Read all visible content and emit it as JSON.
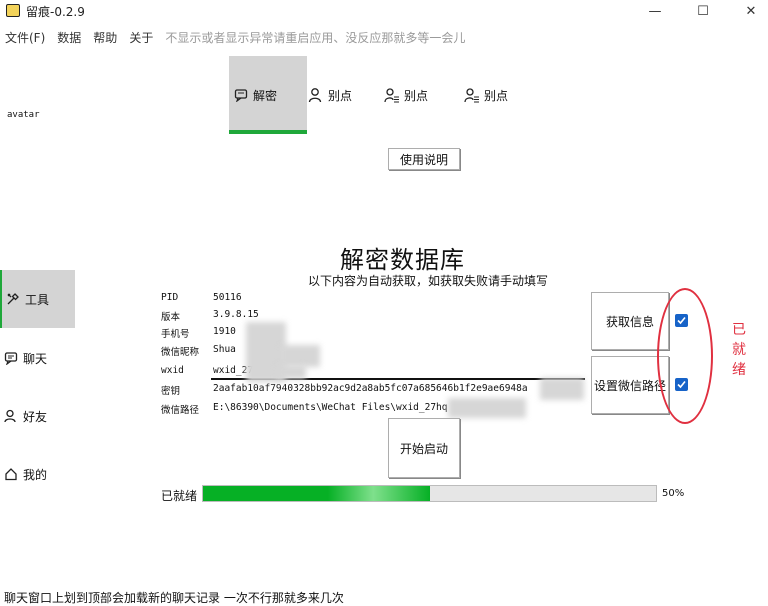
{
  "window": {
    "title": "留痕-0.2.9",
    "controls": {
      "minimize": "—",
      "maximize": "☐",
      "close": "✕"
    }
  },
  "menu": {
    "items": [
      "文件(F)",
      "数据",
      "帮助",
      "关于"
    ],
    "note": "不显示或者显示异常请重启应用、没反应那就多等一会儿"
  },
  "sidebar": {
    "avatar_label": "avatar",
    "items": [
      {
        "label": "工具",
        "icon": "tools-icon",
        "active": true
      },
      {
        "label": "聊天",
        "icon": "chat-icon",
        "active": false
      },
      {
        "label": "好友",
        "icon": "friends-icon",
        "active": false
      },
      {
        "label": "我的",
        "icon": "home-icon",
        "active": false
      }
    ]
  },
  "tabs": [
    {
      "label": "解密",
      "icon": "chat-bubble-icon",
      "active": true
    },
    {
      "label": "别点",
      "icon": "user-icon",
      "active": false
    },
    {
      "label": "别点",
      "icon": "user-list-icon",
      "active": false
    },
    {
      "label": "别点",
      "icon": "user-list-icon",
      "active": false
    }
  ],
  "help_button": "使用说明",
  "heading": "解密数据库",
  "subheading": "以下内容为自动获取，如获取失败请手动填写",
  "info": {
    "pid_label": "PID",
    "pid": "50116",
    "version_label": "版本",
    "version": "3.9.8.15",
    "phone_label": "手机号",
    "phone": "1910",
    "nickname_label": "微信昵称",
    "nickname": "Shua",
    "wxid_label": "wxid",
    "wxid": "wxid_27hqbg",
    "key_label": "密钥",
    "key": "2aafab10af7940328bb92ac9d2a8ab5fc07a685646b1f2e9ae6948a",
    "path_label": "微信路径",
    "path": "E:\\86390\\Documents\\WeChat Files\\wxid_27hq"
  },
  "buttons": {
    "get_info": "获取信息",
    "set_path": "设置微信路径",
    "start": "开始启动"
  },
  "checkboxes": {
    "get_info_checked": true,
    "set_path_checked": true
  },
  "annotation": {
    "text": "已就绪",
    "color": "#e03040"
  },
  "progress": {
    "label": "已就绪",
    "value": 0.5,
    "percent_text": "50%",
    "color": "#06b025"
  },
  "status_bar": "聊天窗口上划到顶部会加载新的聊天记录 一次不行那就多来几次"
}
